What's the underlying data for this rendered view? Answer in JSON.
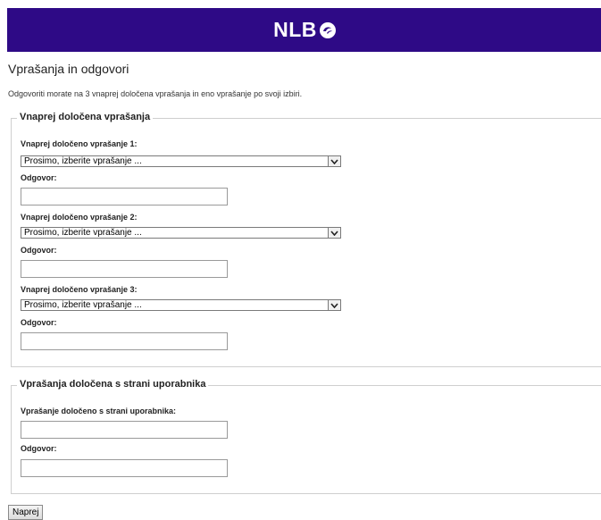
{
  "header": {
    "logo_text": "NLB"
  },
  "page": {
    "title": "Vprašanja in odgovori",
    "intro": "Odgovoriti morate na 3 vnaprej določena vprašanja in eno vprašanje po svoji izbiri."
  },
  "predefined": {
    "legend": "Vnaprej določena vprašanja",
    "questions": [
      {
        "label": "Vnaprej določeno vprašanje 1:",
        "selected": "Prosimo, izberite vprašanje ...",
        "answer_label": "Odgovor:",
        "answer_value": ""
      },
      {
        "label": "Vnaprej določeno vprašanje 2:",
        "selected": "Prosimo, izberite vprašanje ...",
        "answer_label": "Odgovor:",
        "answer_value": ""
      },
      {
        "label": "Vnaprej določeno vprašanje 3:",
        "selected": "Prosimo, izberite vprašanje ...",
        "answer_label": "Odgovor:",
        "answer_value": ""
      }
    ]
  },
  "user_defined": {
    "legend": "Vprašanja določena s strani uporabnika",
    "question_label": "Vprašanje določeno s strani uporabnika:",
    "question_value": "",
    "answer_label": "Odgovor:",
    "answer_value": ""
  },
  "actions": {
    "next_label": "Naprej"
  },
  "colors": {
    "header_bg": "#2e0a86",
    "border": "#cfcfcf"
  }
}
